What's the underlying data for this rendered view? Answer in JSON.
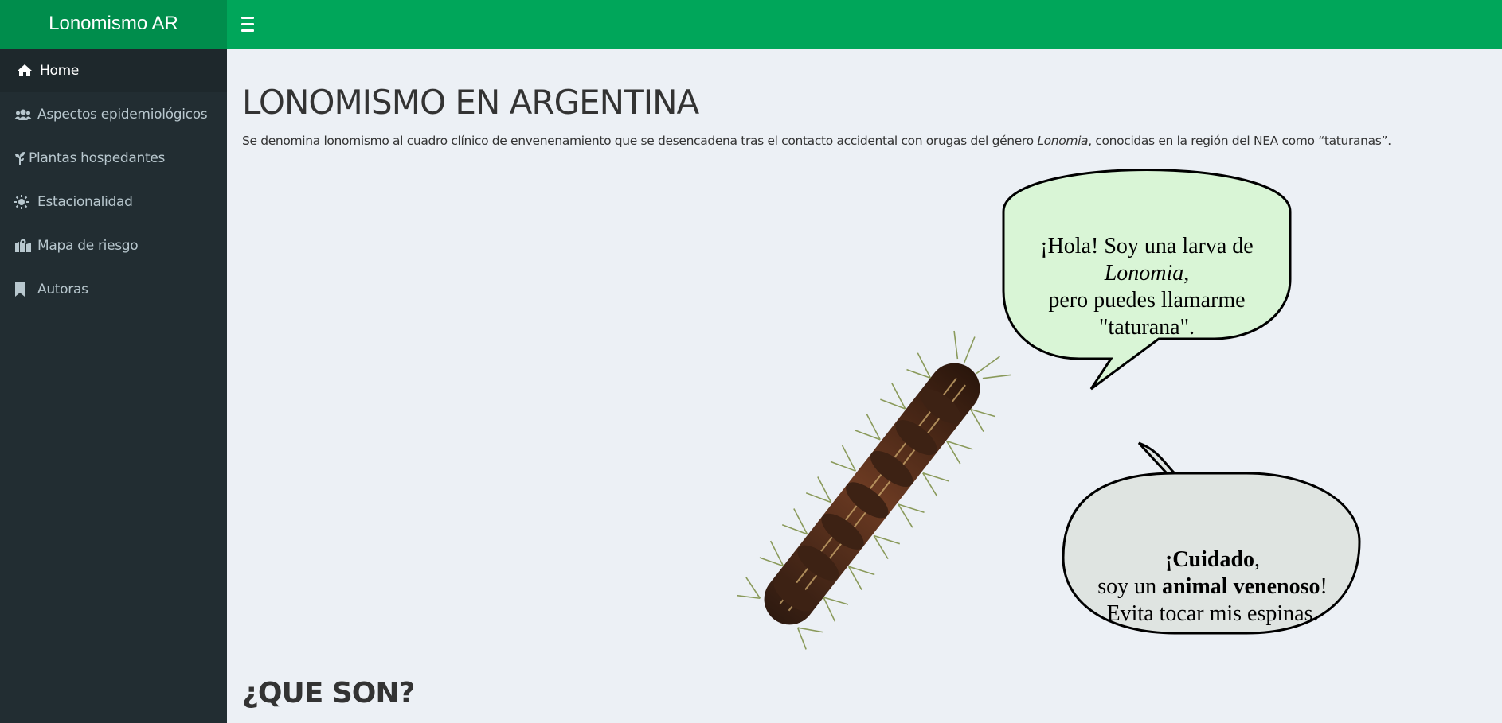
{
  "app": {
    "title": "Lonomismo AR"
  },
  "header": {
    "menu_toggle": "menu-toggle"
  },
  "sidebar": {
    "items": [
      {
        "label": "Home",
        "icon": "home-icon",
        "active": true
      },
      {
        "label": "Aspectos epidemiológicos",
        "icon": "users-icon"
      },
      {
        "label": "Plantas hospedantes",
        "icon": "seedling-icon"
      },
      {
        "label": "Estacionalidad",
        "icon": "sun-icon"
      },
      {
        "label": "Mapa de riesgo",
        "icon": "map-icon"
      },
      {
        "label": "Autoras",
        "icon": "bookmark-icon"
      }
    ]
  },
  "main": {
    "title": "LONOMISMO EN ARGENTINA",
    "intro_pre": "Se denomina lonomismo al cuadro clínico de envenenamiento que se desencadena tras el contacto accidental con orugas del género ",
    "intro_italic": "Lonomia",
    "intro_post": ", conocidas en la región del NEA como “taturanas”.",
    "bubble_top": {
      "line1": "¡Hola! Soy una larva de",
      "line2": "Lonomia",
      "line2_suffix": ",",
      "line3": "pero puedes llamarme",
      "line4": "\"taturana\"."
    },
    "bubble_bottom": {
      "line1_bold": "¡Cuidado",
      "line1_suffix": ",",
      "line2_pre": "soy un ",
      "line2_bold": "animal venenoso",
      "line2_suffix": "!",
      "line3": "Evita tocar mis espinas."
    },
    "subtitle": "¿QUE SON?"
  },
  "colors": {
    "header": "#00a65a",
    "logo_bg": "#008d4c",
    "sidebar_bg": "#222d32",
    "content_bg": "#ecf0f5",
    "bubble_top_fill": "#d9f5d6",
    "bubble_bottom_fill": "#dfe4e1"
  }
}
